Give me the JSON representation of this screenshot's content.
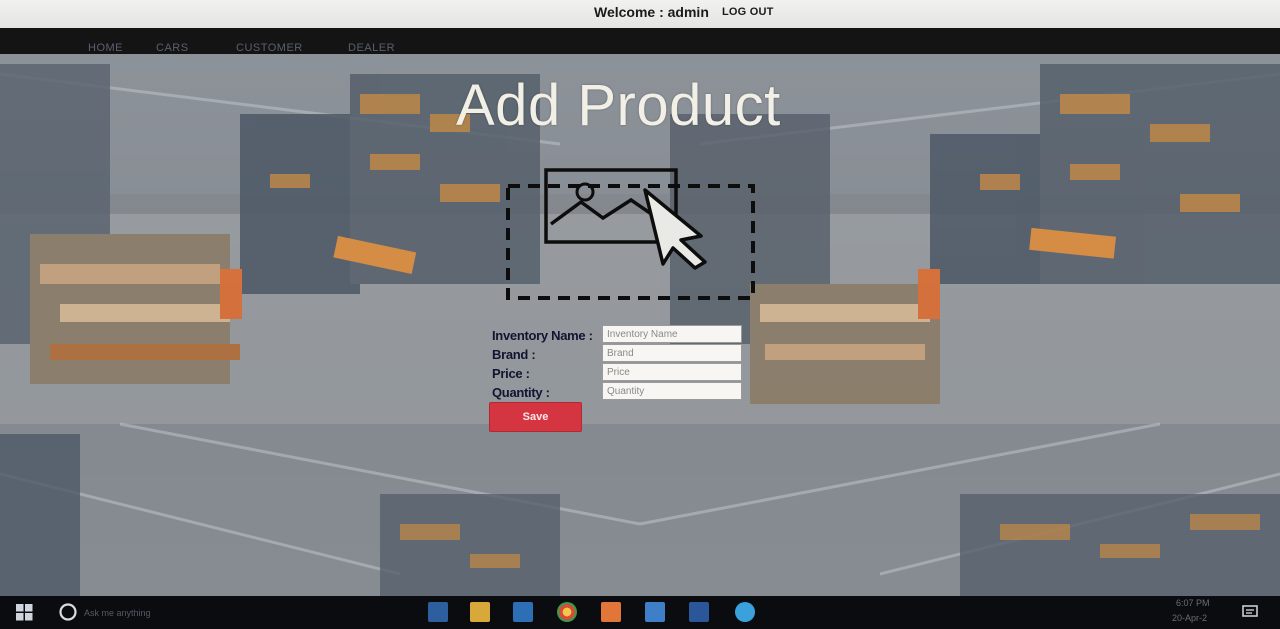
{
  "header": {
    "welcome_text": "Welcome : admin",
    "logout_label": "LOG OUT"
  },
  "nav": {
    "items": [
      {
        "label": "HOME"
      },
      {
        "label": "CARS"
      },
      {
        "label": "CUSTOMER"
      },
      {
        "label": "DEALER"
      }
    ]
  },
  "main": {
    "title": "Add Product",
    "image_upload_icon": "image-upload-icon"
  },
  "form": {
    "fields": [
      {
        "label": "Inventory Name :",
        "placeholder": "Inventory Name",
        "value": ""
      },
      {
        "label": "Brand :",
        "placeholder": "Brand",
        "value": ""
      },
      {
        "label": "Price :",
        "placeholder": "Price",
        "value": ""
      },
      {
        "label": "Quantity :",
        "placeholder": "Quantity",
        "value": ""
      }
    ],
    "save_label": "Save"
  },
  "taskbar": {
    "search_placeholder": "Ask me anything",
    "icons": [
      "windows-start-icon",
      "cortana-icon",
      "task-view-icon",
      "file-explorer-icon",
      "store-icon",
      "chrome-icon",
      "paint-icon",
      "security-icon",
      "word-icon",
      "ie-icon"
    ],
    "clock_time": "6:07 PM",
    "clock_date": "20-Apr-2"
  },
  "colors": {
    "accent_save": "#d53540",
    "navbar": "#141414",
    "taskbar": "#0b0c10",
    "title_text": "#f2f0e6"
  }
}
